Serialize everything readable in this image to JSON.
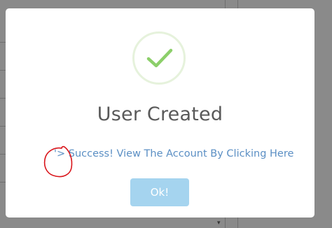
{
  "dialog": {
    "title": "User Created",
    "message_link": "'> Success! View The Account By Clicking Here",
    "ok_label": "Ok!",
    "icon": "checkmark-icon"
  },
  "colors": {
    "backdrop": "#8a8a8a",
    "check": "#8ccf6a",
    "ring": "#e6f2dc",
    "link": "#5b8fc4",
    "button": "#a5d4ef",
    "annotation": "#d9141a"
  },
  "background": {
    "scroll_arrow": "▾"
  }
}
